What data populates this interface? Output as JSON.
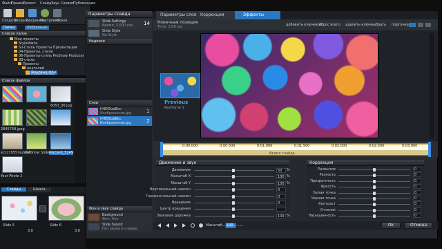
{
  "window": {
    "title": "Параметры слайда"
  },
  "menu": [
    "Файл",
    "Правка",
    "Проект",
    "Слайд",
    "Звук",
    "Сервис",
    "Публикация"
  ],
  "toolbar": [
    "Создать",
    "Открыть",
    "Сохранить",
    "Настройки",
    "Показ"
  ],
  "folders_tabs": [
    "Папки",
    "Избранные"
  ],
  "folders_header": "Список папок",
  "folder_items": [
    "Мои проекты",
    "StyleMarks",
    "Sli-Стиль Проекты Презентация",
    "04-Проекты, стили",
    "06-Проекты-стиль ProShow Producer",
    "38-стиль",
    "Проекты",
    "анатолий",
    "Фоновые фон",
    "Новая папка"
  ],
  "files_header": "Список файлов",
  "file_names": [
    "",
    "",
    "6053_00.jpg",
    "2845768.jpeg",
    "",
    "",
    "eccc70557e2ea4",
    "ProShow Slide",
    "rescued_5249",
    "Your Photo 2",
    "",
    ""
  ],
  "slide_settings": {
    "slide_name": "Slide Settings",
    "slide_sub": "Время: 3.000 сек",
    "slide_style": "Slide Style",
    "slide_style_sub": "No Style",
    "badge": "14",
    "captions_header": "Надписи",
    "layers_header": "Слои",
    "layers": [
      {
        "name": "f-HDDizaBcc",
        "sub": "Изображение.jpg",
        "num": "1"
      },
      {
        "name": "f-HDDizaBcc",
        "sub": "Изображение.jpg",
        "num": "2"
      }
    ],
    "bg_header": "Фон и звук слайда",
    "bg_label": "Background",
    "bg_sub": "Фон: Нет",
    "sound_label": "Slide Sound",
    "sound_sub": "Нет звука в слайде"
  },
  "tabs": [
    "Параметры слоя",
    "Коррекция",
    "Эффекты"
  ],
  "keyframe": {
    "title": "Конечная позиция",
    "time": "Time: 3.00 sec",
    "previous": "Previous",
    "keyframe_label": "Keyframe 1",
    "btns": [
      "добавить ключевой",
      "сброс всего",
      "удалить ключ",
      "выбрать",
      "подгонка"
    ]
  },
  "timeline": {
    "ticks": [
      "0:00.000",
      "0:00.500",
      "0:01.000",
      "0:01.500",
      "0:02.000",
      "0:02.500",
      "0:03.000"
    ],
    "label": "Время слайда"
  },
  "motion": {
    "header": "Движение и звук",
    "rows": [
      {
        "label": "Движение",
        "v1": "0",
        "v2": "",
        "label2": "Кривая",
        "v3": "50",
        "unit": "%"
      },
      {
        "label": "Масштаб X",
        "v1": "",
        "v2": "",
        "v3": "100",
        "unit": "%"
      },
      {
        "label": "Масштаб Y",
        "v1": "",
        "v2": "",
        "v3": "100",
        "unit": "%"
      },
      {
        "label": "Вертикальный наклон",
        "v1": "",
        "v2": "",
        "v3": "0",
        "unit": ""
      },
      {
        "label": "Горизонтальный наклон",
        "v1": "",
        "v2": "",
        "v3": "0",
        "unit": ""
      },
      {
        "label": "Вращение",
        "v1": "",
        "v2": "",
        "v3": "0",
        "unit": ""
      },
      {
        "label": "Центр вращения",
        "v1": "0",
        "v2": "0",
        "v3": "",
        "unit": ""
      },
      {
        "label": "Звуковая дорожка",
        "v1": "",
        "v2": "",
        "v3": "100",
        "unit": "%"
      }
    ]
  },
  "correction": {
    "header": "Коррекция",
    "rows": [
      {
        "label": "Размытие",
        "val": "0"
      },
      {
        "label": "Резкость",
        "val": "0"
      },
      {
        "label": "Прозрачность",
        "val": "0"
      },
      {
        "label": "Яркость",
        "val": "0"
      },
      {
        "label": "Белая точка",
        "val": "0"
      },
      {
        "label": "Черная точка",
        "val": "0"
      },
      {
        "label": "Контраст",
        "val": "0"
      },
      {
        "label": "Оттенок",
        "val": "0"
      },
      {
        "label": "Насыщенность",
        "val": "0"
      }
    ],
    "color_label": "Цвет",
    "color2_label": "Цвет"
  },
  "transport": {
    "zoom_label": "Масштаб",
    "zoom_value": "100"
  },
  "footer_buttons": [
    "Ok",
    "Отмена"
  ],
  "bottom_tabs": [
    "Слайды",
    "Шкала"
  ],
  "slides": [
    {
      "label": "Slide 5",
      "dur": "3.0",
      "bg": "#dfe6ee"
    },
    {
      "label": "Slide 6",
      "dur": "3.0",
      "bg": "#e6dedb"
    }
  ],
  "palette": {
    "accent": "#2a77c4",
    "dark": "#1c1f23"
  }
}
